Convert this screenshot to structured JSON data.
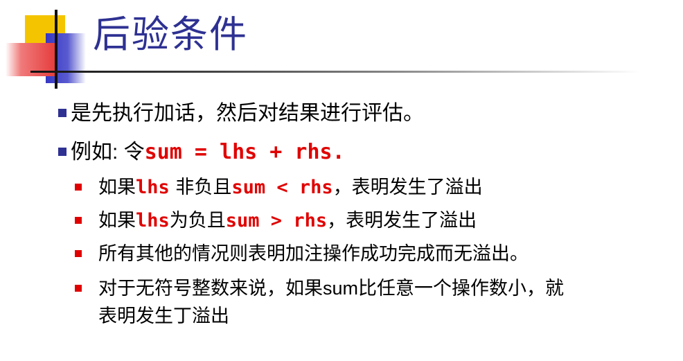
{
  "title": "后验条件",
  "bullets": {
    "b1": "是先执行加话，然后对结果进行评估。",
    "b2_prefix": "例如",
    "b2_colon": ": ",
    "b2_word": "令",
    "b2_code": "sum = lhs + rhs."
  },
  "sub": {
    "s1_a": "如果",
    "s1_code1": "lhs",
    "s1_b": " 非负且",
    "s1_code2": "sum < rhs",
    "s1_c": "，表明发生了溢出",
    "s2_a": "如果",
    "s2_code1": "lhs",
    "s2_b": "为负且",
    "s2_code2": "sum > rhs",
    "s2_c": "，表明发生了溢出",
    "s3": "所有其他的情况则表明加注操作成功完成而无溢出。",
    "s4_a": "对于无符号整数来说，如果",
    "s4_sum": "sum",
    "s4_b": "比任意一个操作数小，就",
    "s4_line2": "表明发生丁溢出"
  },
  "colors": {
    "title": "#2e3192",
    "bullet_level1": "#2e3192",
    "bullet_level2": "#e00000",
    "code": "#e00000"
  }
}
